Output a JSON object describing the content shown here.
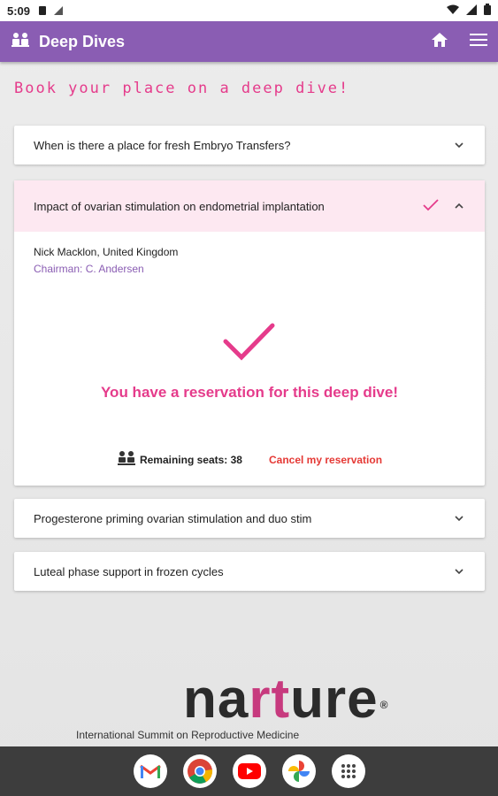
{
  "status": {
    "time": "5:09"
  },
  "appbar": {
    "title": "Deep Dives",
    "app_icon": "seats-icon",
    "home_icon": "home-icon",
    "menu_icon": "menu-icon"
  },
  "heading": "Book your place on a deep dive!",
  "cards": [
    {
      "title": "When is there a place for fresh Embryo Transfers?"
    },
    {
      "title": "Impact of ovarian stimulation on endometrial implantation",
      "speaker": "Nick Macklon, United Kingdom",
      "chairman": "Chairman: C. Andersen",
      "reserved_text": "You have a reservation for this deep dive!",
      "seats_text": "Remaining seats: 38",
      "cancel_text": "Cancel my reservation"
    },
    {
      "title": "Progesterone priming ovarian stimulation and duo stim"
    },
    {
      "title": "Luteal phase support in frozen cycles"
    }
  ],
  "footer": {
    "logo_prefix": "na",
    "logo_highlight": "rt",
    "logo_suffix": "ure",
    "logo_mark": "®",
    "tagline": "International Summit on Reproductive Medicine"
  },
  "colors": {
    "accent": "#8a5db3",
    "pink": "#e53b8b",
    "cancel": "#e53935"
  },
  "dock": [
    "gmail-icon",
    "chrome-icon",
    "youtube-icon",
    "photos-icon",
    "apps-icon"
  ]
}
